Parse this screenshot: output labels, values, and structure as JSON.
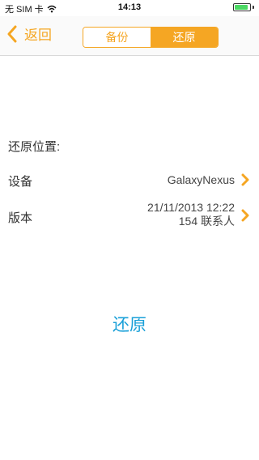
{
  "status_bar": {
    "carrier": "无 SIM 卡",
    "time": "14:13",
    "battery_level": 0.9
  },
  "nav": {
    "back_label": "返回",
    "segments": [
      "备份",
      "还原"
    ],
    "active_segment": 1
  },
  "content": {
    "section_title": "还原位置:",
    "device_label": "设备",
    "device_value": "GalaxyNexus",
    "version_label": "版本",
    "version_date": "21/11/2013 12:22",
    "version_contacts": "154 联系人",
    "restore_button": "还原"
  },
  "colors": {
    "accent": "#f5a623",
    "link": "#1aa0d8"
  }
}
